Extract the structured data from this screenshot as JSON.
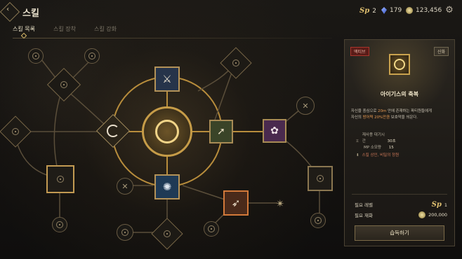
{
  "header": {
    "title": "스킬",
    "back_icon": "back-arrow-icon",
    "currencies": [
      {
        "icon": "sp-icon",
        "label": "Sp",
        "value": "2"
      },
      {
        "icon": "blue-gem-icon",
        "value": "179"
      },
      {
        "icon": "gold-coin-icon",
        "value": "123,456"
      }
    ],
    "settings_icon": "gear-icon"
  },
  "tabs": [
    {
      "label": "스킬 목록",
      "active": true
    },
    {
      "label": "스킬 장착",
      "active": false
    },
    {
      "label": "스킬 강화",
      "active": false
    }
  ],
  "panel": {
    "tag_left": "액티브",
    "tag_right": "신화",
    "skill_icon": "shield-wheel-icon",
    "skill_name": "아이기스의 축복",
    "desc_line1_a": "자신을 중심으로 ",
    "desc_line1_hl": "20m",
    "desc_line1_b": " 안에 존재하는 파티원들에게",
    "desc_line2_a": "자신의 ",
    "desc_line2_hl": "방어력 20%만큼",
    "desc_line2_b": " 보호막을 씌운다.",
    "stats": [
      {
        "label": "재사용 대기시간",
        "value": "30초"
      },
      {
        "label": "MP 소모량",
        "value": "15"
      }
    ],
    "source_text": "스킬 상인, 비밀의 정원",
    "req_level_label": "필요 레벨",
    "req_level_sp": "Sp",
    "req_level_value": "1",
    "req_gold_label": "필요 재화",
    "req_gold_value": "200,000",
    "acquire_label": "습득하기"
  },
  "colors": {
    "accent_gold": "#c9a24e",
    "tag_red": "#a8352c",
    "highlight_orange": "#e89a52",
    "source_red": "#d07a5a"
  }
}
